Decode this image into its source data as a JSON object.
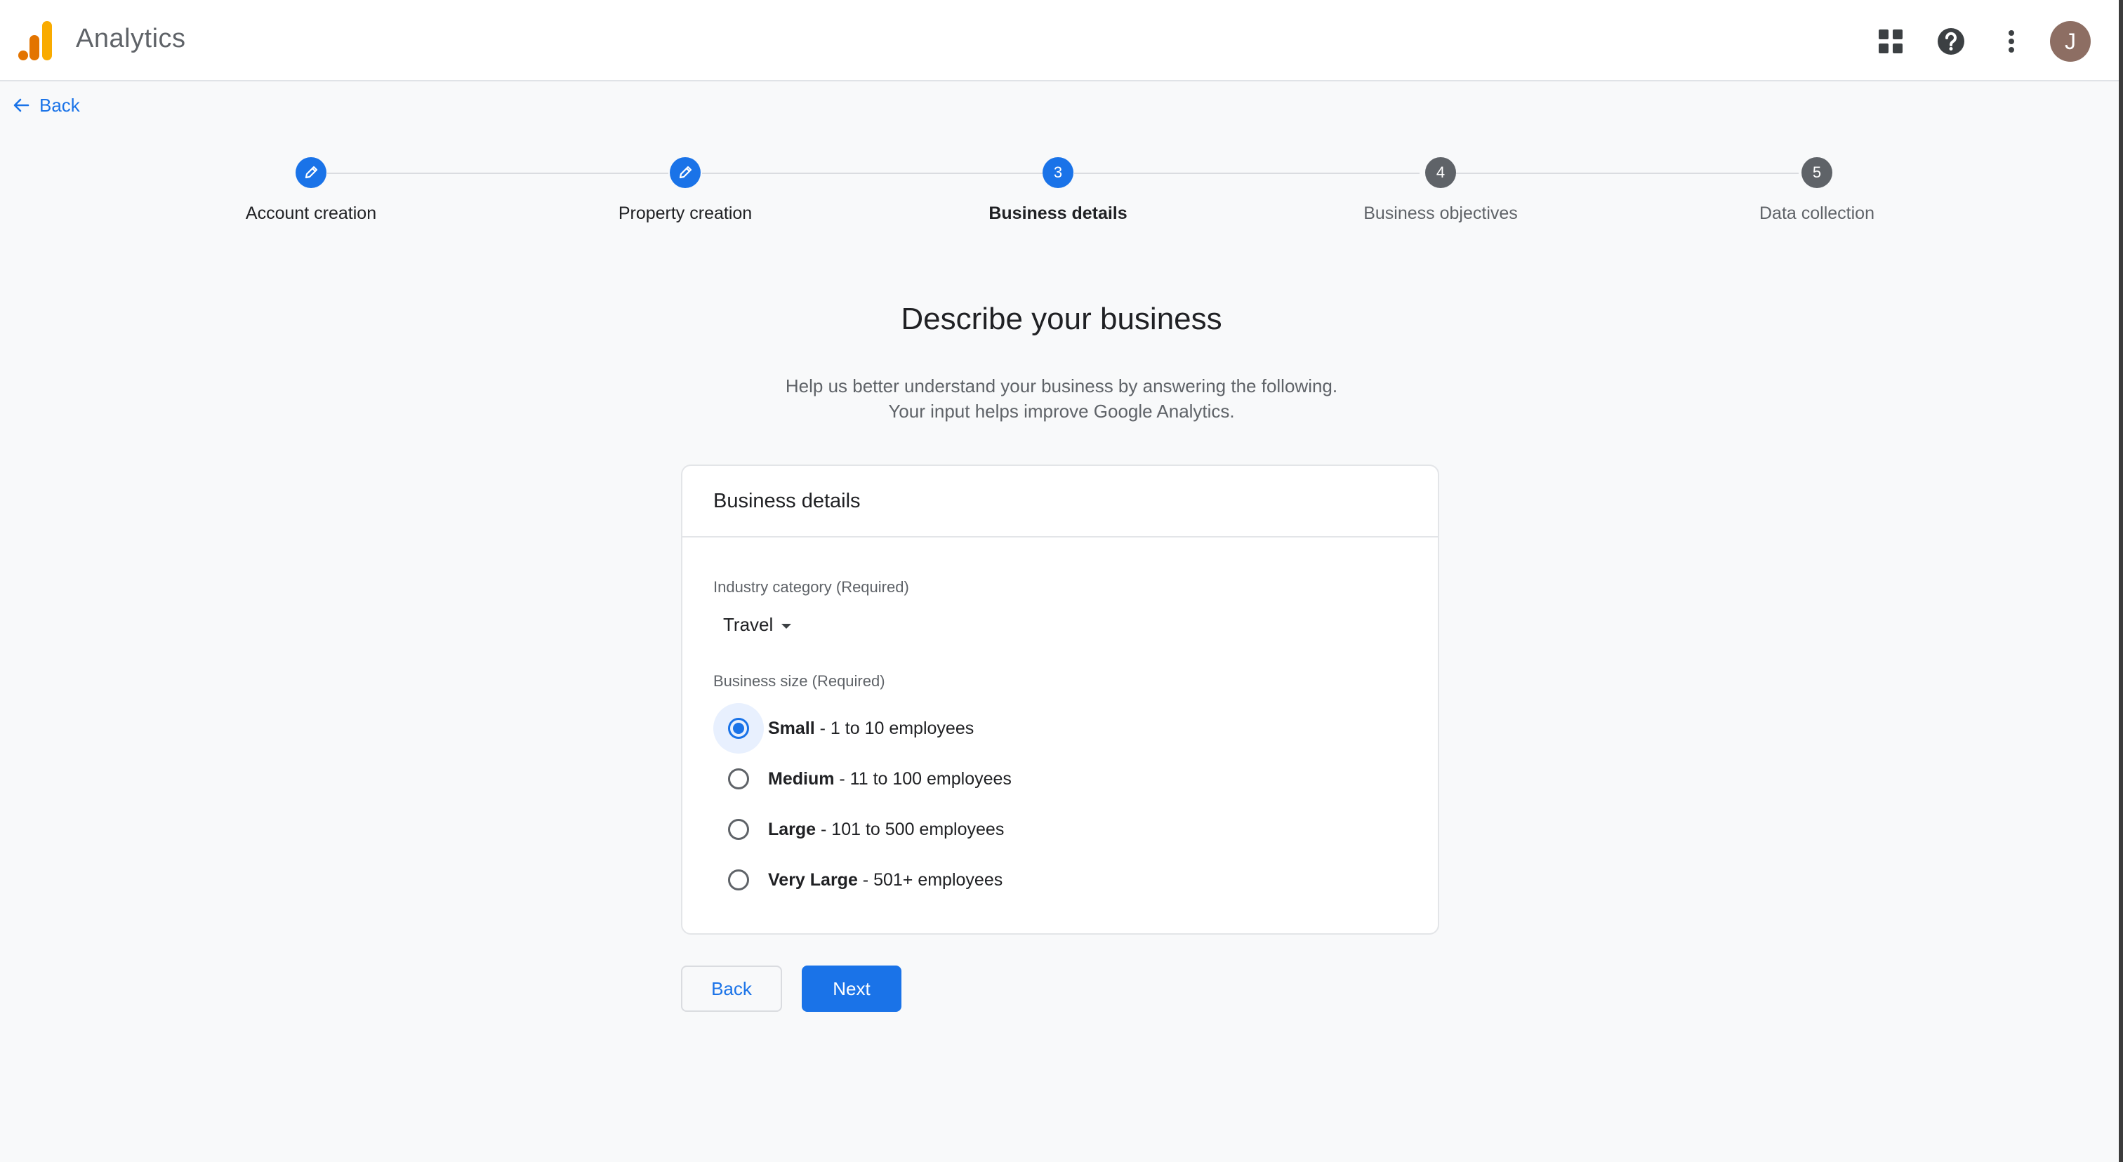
{
  "header": {
    "app_name": "Analytics",
    "icons": [
      "apps-grid-icon",
      "help-icon",
      "more-vert-icon"
    ],
    "avatar_initial": "J",
    "logo_colors": [
      "#f9ab00",
      "#e37400"
    ]
  },
  "nav": {
    "back_label": "Back"
  },
  "stepper": {
    "steps": [
      {
        "label": "Account creation",
        "status": "done",
        "marker": ""
      },
      {
        "label": "Property creation",
        "status": "done",
        "marker": ""
      },
      {
        "label": "Business details",
        "status": "active",
        "marker": "3"
      },
      {
        "label": "Business objectives",
        "status": "todo",
        "marker": "4"
      },
      {
        "label": "Data collection",
        "status": "todo",
        "marker": "5"
      }
    ]
  },
  "main": {
    "title": "Describe your business",
    "subtitle_line1": "Help us better understand your business by answering the following.",
    "subtitle_line2": "Your input helps improve Google Analytics."
  },
  "card": {
    "title": "Business details",
    "industry": {
      "label": "Industry category (Required)",
      "selected": "Travel"
    },
    "size": {
      "label": "Business size (Required)",
      "options": [
        {
          "name": "Small",
          "detail": " - 1 to 10 employees",
          "selected": true
        },
        {
          "name": "Medium",
          "detail": " - 11 to 100 employees",
          "selected": false
        },
        {
          "name": "Large",
          "detail": " - 101 to 500 employees",
          "selected": false
        },
        {
          "name": "Very Large",
          "detail": " - 501+ employees",
          "selected": false
        }
      ]
    }
  },
  "actions": {
    "back_label": "Back",
    "next_label": "Next"
  },
  "colors": {
    "primary": "#1a73e8",
    "inactive_step": "#5f6368",
    "selected_halo": "#e8f0fe"
  }
}
